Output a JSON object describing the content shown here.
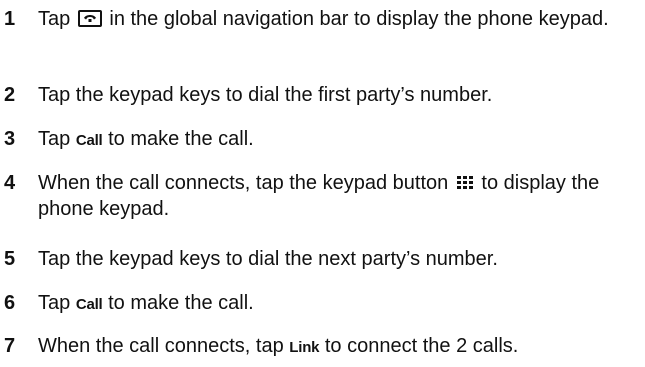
{
  "steps": [
    {
      "number": "1",
      "before": "Tap",
      "icon": "phone-icon",
      "after": "in the global navigation bar to display the phone keypad."
    },
    {
      "number": "2",
      "text": "Tap the keypad keys to dial the first party’s number."
    },
    {
      "number": "3",
      "before": "Tap",
      "ui": "Call",
      "after": "to make the call."
    },
    {
      "number": "4",
      "before": "When the call connects, tap the keypad button",
      "icon": "keypad-grid-icon",
      "after": "to display the phone keypad."
    },
    {
      "number": "5",
      "text": "Tap the keypad keys to dial the next party’s number."
    },
    {
      "number": "6",
      "before": "Tap",
      "ui": "Call",
      "after": "to make the call."
    },
    {
      "number": "7",
      "before": "When the call connects, tap",
      "ui": "Link",
      "after": "to connect the 2 calls."
    }
  ]
}
